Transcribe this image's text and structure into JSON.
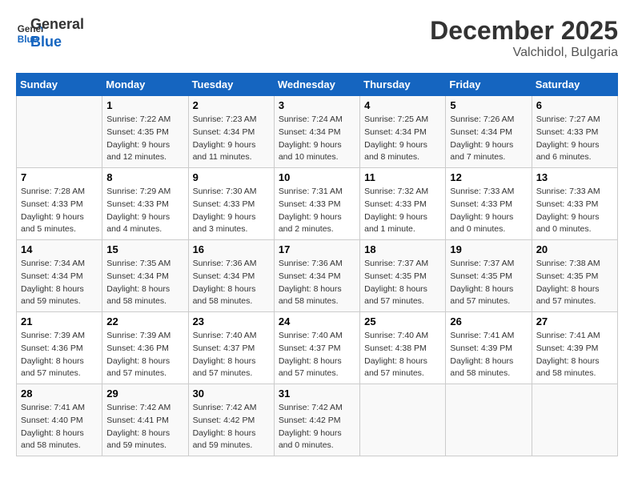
{
  "header": {
    "logo_line1": "General",
    "logo_line2": "Blue",
    "month": "December 2025",
    "location": "Valchidol, Bulgaria"
  },
  "weekdays": [
    "Sunday",
    "Monday",
    "Tuesday",
    "Wednesday",
    "Thursday",
    "Friday",
    "Saturday"
  ],
  "weeks": [
    [
      {
        "day": "",
        "info": ""
      },
      {
        "day": "1",
        "info": "Sunrise: 7:22 AM\nSunset: 4:35 PM\nDaylight: 9 hours\nand 12 minutes."
      },
      {
        "day": "2",
        "info": "Sunrise: 7:23 AM\nSunset: 4:34 PM\nDaylight: 9 hours\nand 11 minutes."
      },
      {
        "day": "3",
        "info": "Sunrise: 7:24 AM\nSunset: 4:34 PM\nDaylight: 9 hours\nand 10 minutes."
      },
      {
        "day": "4",
        "info": "Sunrise: 7:25 AM\nSunset: 4:34 PM\nDaylight: 9 hours\nand 8 minutes."
      },
      {
        "day": "5",
        "info": "Sunrise: 7:26 AM\nSunset: 4:34 PM\nDaylight: 9 hours\nand 7 minutes."
      },
      {
        "day": "6",
        "info": "Sunrise: 7:27 AM\nSunset: 4:33 PM\nDaylight: 9 hours\nand 6 minutes."
      }
    ],
    [
      {
        "day": "7",
        "info": "Sunrise: 7:28 AM\nSunset: 4:33 PM\nDaylight: 9 hours\nand 5 minutes."
      },
      {
        "day": "8",
        "info": "Sunrise: 7:29 AM\nSunset: 4:33 PM\nDaylight: 9 hours\nand 4 minutes."
      },
      {
        "day": "9",
        "info": "Sunrise: 7:30 AM\nSunset: 4:33 PM\nDaylight: 9 hours\nand 3 minutes."
      },
      {
        "day": "10",
        "info": "Sunrise: 7:31 AM\nSunset: 4:33 PM\nDaylight: 9 hours\nand 2 minutes."
      },
      {
        "day": "11",
        "info": "Sunrise: 7:32 AM\nSunset: 4:33 PM\nDaylight: 9 hours\nand 1 minute."
      },
      {
        "day": "12",
        "info": "Sunrise: 7:33 AM\nSunset: 4:33 PM\nDaylight: 9 hours\nand 0 minutes."
      },
      {
        "day": "13",
        "info": "Sunrise: 7:33 AM\nSunset: 4:33 PM\nDaylight: 9 hours\nand 0 minutes."
      }
    ],
    [
      {
        "day": "14",
        "info": "Sunrise: 7:34 AM\nSunset: 4:34 PM\nDaylight: 8 hours\nand 59 minutes."
      },
      {
        "day": "15",
        "info": "Sunrise: 7:35 AM\nSunset: 4:34 PM\nDaylight: 8 hours\nand 58 minutes."
      },
      {
        "day": "16",
        "info": "Sunrise: 7:36 AM\nSunset: 4:34 PM\nDaylight: 8 hours\nand 58 minutes."
      },
      {
        "day": "17",
        "info": "Sunrise: 7:36 AM\nSunset: 4:34 PM\nDaylight: 8 hours\nand 58 minutes."
      },
      {
        "day": "18",
        "info": "Sunrise: 7:37 AM\nSunset: 4:35 PM\nDaylight: 8 hours\nand 57 minutes."
      },
      {
        "day": "19",
        "info": "Sunrise: 7:37 AM\nSunset: 4:35 PM\nDaylight: 8 hours\nand 57 minutes."
      },
      {
        "day": "20",
        "info": "Sunrise: 7:38 AM\nSunset: 4:35 PM\nDaylight: 8 hours\nand 57 minutes."
      }
    ],
    [
      {
        "day": "21",
        "info": "Sunrise: 7:39 AM\nSunset: 4:36 PM\nDaylight: 8 hours\nand 57 minutes."
      },
      {
        "day": "22",
        "info": "Sunrise: 7:39 AM\nSunset: 4:36 PM\nDaylight: 8 hours\nand 57 minutes."
      },
      {
        "day": "23",
        "info": "Sunrise: 7:40 AM\nSunset: 4:37 PM\nDaylight: 8 hours\nand 57 minutes."
      },
      {
        "day": "24",
        "info": "Sunrise: 7:40 AM\nSunset: 4:37 PM\nDaylight: 8 hours\nand 57 minutes."
      },
      {
        "day": "25",
        "info": "Sunrise: 7:40 AM\nSunset: 4:38 PM\nDaylight: 8 hours\nand 57 minutes."
      },
      {
        "day": "26",
        "info": "Sunrise: 7:41 AM\nSunset: 4:39 PM\nDaylight: 8 hours\nand 58 minutes."
      },
      {
        "day": "27",
        "info": "Sunrise: 7:41 AM\nSunset: 4:39 PM\nDaylight: 8 hours\nand 58 minutes."
      }
    ],
    [
      {
        "day": "28",
        "info": "Sunrise: 7:41 AM\nSunset: 4:40 PM\nDaylight: 8 hours\nand 58 minutes."
      },
      {
        "day": "29",
        "info": "Sunrise: 7:42 AM\nSunset: 4:41 PM\nDaylight: 8 hours\nand 59 minutes."
      },
      {
        "day": "30",
        "info": "Sunrise: 7:42 AM\nSunset: 4:42 PM\nDaylight: 8 hours\nand 59 minutes."
      },
      {
        "day": "31",
        "info": "Sunrise: 7:42 AM\nSunset: 4:42 PM\nDaylight: 9 hours\nand 0 minutes."
      },
      {
        "day": "",
        "info": ""
      },
      {
        "day": "",
        "info": ""
      },
      {
        "day": "",
        "info": ""
      }
    ]
  ]
}
